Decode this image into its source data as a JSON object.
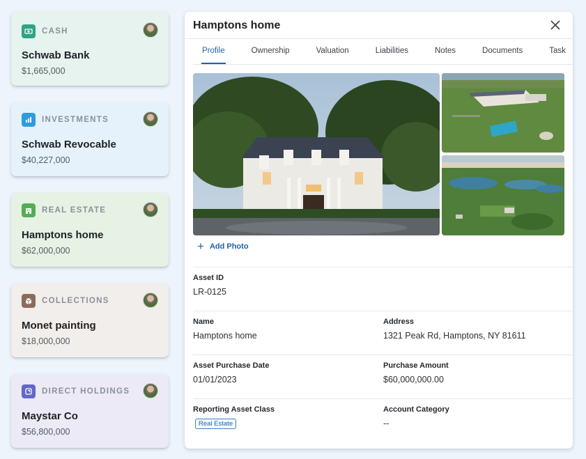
{
  "cards": [
    {
      "category": "CASH",
      "name": "Schwab Bank",
      "value": "$1,665,000",
      "bg": "#e6f3ef",
      "icon_bg": "#2fa384",
      "icon": "cash-icon"
    },
    {
      "category": "INVESTMENTS",
      "name": "Schwab Revocable",
      "value": "$40,227,000",
      "bg": "#e6f2fb",
      "icon_bg": "#2f9be0",
      "icon": "chart-bar-icon"
    },
    {
      "category": "REAL ESTATE",
      "name": "Hamptons home",
      "value": "$62,000,000",
      "bg": "#e6f2e3",
      "icon_bg": "#54ad56",
      "icon": "building-icon"
    },
    {
      "category": "COLLECTIONS",
      "name": "Monet painting",
      "value": "$18,000,000",
      "bg": "#f2eeeb",
      "icon_bg": "#8b6d5f",
      "icon": "collection-box-icon"
    },
    {
      "category": "DIRECT HOLDINGS",
      "name": "Maystar Co",
      "value": "$56,800,000",
      "bg": "#ebeaf6",
      "icon_bg": "#6268c6",
      "icon": "holdings-icon"
    }
  ],
  "panel": {
    "title": "Hamptons home",
    "tabs": [
      "Profile",
      "Ownership",
      "Valuation",
      "Liabilities",
      "Notes",
      "Documents",
      "Task"
    ],
    "active_tab": "Profile",
    "add_photo": "Add Photo",
    "fields": {
      "asset_id_label": "Asset ID",
      "asset_id": "LR-0125",
      "name_label": "Name",
      "name": "Hamptons home",
      "address_label": "Address",
      "address": "1321 Peak Rd, Hamptons, NY 81611",
      "purchase_date_label": "Asset Purchase Date",
      "purchase_date": "01/01/2023",
      "purchase_amount_label": "Purchase Amount",
      "purchase_amount": "$60,000,000.00",
      "reporting_class_label": "Reporting Asset Class",
      "reporting_class": "Real Estate",
      "account_category_label": "Account Category",
      "account_category": "--"
    }
  },
  "colors": {
    "accent": "#1f63a8",
    "page_bg": "#eef4fb"
  }
}
